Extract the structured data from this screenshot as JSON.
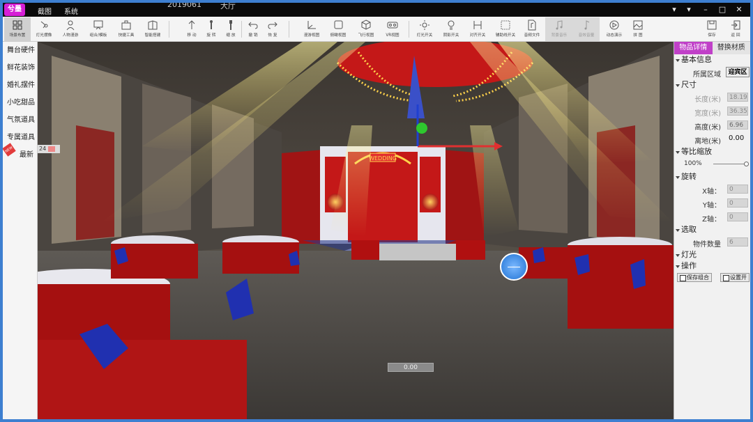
{
  "titlebar": {
    "logo": "兮墨",
    "menu": [
      "截图",
      "系统"
    ],
    "file_title": "2019061",
    "file_title2": "大厅",
    "controls": {
      "minimize": "▾",
      "restore": "▾",
      "min2": "–",
      "max": "□",
      "close": "✕"
    }
  },
  "toolbar": {
    "items": [
      {
        "label": "场景布置",
        "icon": "grid-icon",
        "active": true
      },
      {
        "label": "灯光摆像",
        "icon": "lamp-icon"
      },
      {
        "label": "人物漫游",
        "icon": "person-icon"
      },
      {
        "label": "组合/模板",
        "icon": "board-icon"
      },
      {
        "label": "快捷工具",
        "icon": "toolbox-icon"
      },
      {
        "label": "智能搭建",
        "icon": "build-icon"
      },
      {
        "label": "移 动",
        "icon": "move-icon"
      },
      {
        "label": "旋 转",
        "icon": "rotate-icon"
      },
      {
        "label": "缩 放",
        "icon": "scale-icon"
      },
      {
        "label": "撤 销",
        "icon": "undo-icon"
      },
      {
        "label": "恢 复",
        "icon": "redo-icon"
      },
      {
        "label": "漫游视图",
        "icon": "axis-icon"
      },
      {
        "label": "俯瞰视图",
        "icon": "square-icon"
      },
      {
        "label": "飞行视图",
        "icon": "cube-icon"
      },
      {
        "label": "VR视图",
        "icon": "vr-icon"
      },
      {
        "label": "灯光开关",
        "icon": "light-icon"
      },
      {
        "label": "阴影开关",
        "icon": "bulb-icon"
      },
      {
        "label": "对齐开关",
        "icon": "align-icon"
      },
      {
        "label": "辅助线开关",
        "icon": "guide-icon"
      },
      {
        "label": "音频文件",
        "icon": "audio-file-icon"
      },
      {
        "label": "背景音乐",
        "icon": "music-icon",
        "disabled": true
      },
      {
        "label": "音效音量",
        "icon": "music-note-icon",
        "disabled": true
      },
      {
        "label": "动态演示",
        "icon": "play-icon"
      },
      {
        "label": "拼 图",
        "icon": "picture-icon"
      },
      {
        "label": "保存",
        "icon": "save-icon"
      },
      {
        "label": "返 回",
        "icon": "exit-icon"
      }
    ]
  },
  "sidebar": {
    "categories": [
      "舞台硬件",
      "鲜花装饰",
      "婚礼摆件",
      "小吃甜品",
      "气氛道具",
      "专属道具",
      "最新"
    ],
    "new_badge": "NEW"
  },
  "viewport": {
    "counter": "24",
    "coordinate": "0.00",
    "stage_sign": "WEDDING"
  },
  "panel": {
    "tabs": [
      "物品详情",
      "替换材质"
    ],
    "basic": {
      "title": "基本信息",
      "region_label": "所属区域",
      "region_value": "迎宾区"
    },
    "size": {
      "title": "尺寸",
      "length_label": "长度(米)",
      "length": "18.19",
      "width_label": "宽度(米)",
      "width": "36.35",
      "height_label": "高度(米)",
      "height": "6.96",
      "offset_label": "离地(米)",
      "offset": "0.00"
    },
    "scale": {
      "title": "等比缩放",
      "value": "100%",
      "level": 1.0
    },
    "rotate": {
      "title": "旋转",
      "x_label": "X轴：",
      "x": "0",
      "y_label": "Y轴：",
      "y": "0",
      "z_label": "Z轴：",
      "z": "0"
    },
    "select": {
      "title": "选取",
      "count_label": "物件数量",
      "count": "6"
    },
    "light": {
      "title": "灯光"
    },
    "ops": {
      "title": "操作",
      "save_group": "保存组合",
      "setting": "设置开"
    }
  },
  "colors": {
    "accent": "#c040c8",
    "logo": "#d61fd6",
    "frame": "#3d7fd0"
  }
}
